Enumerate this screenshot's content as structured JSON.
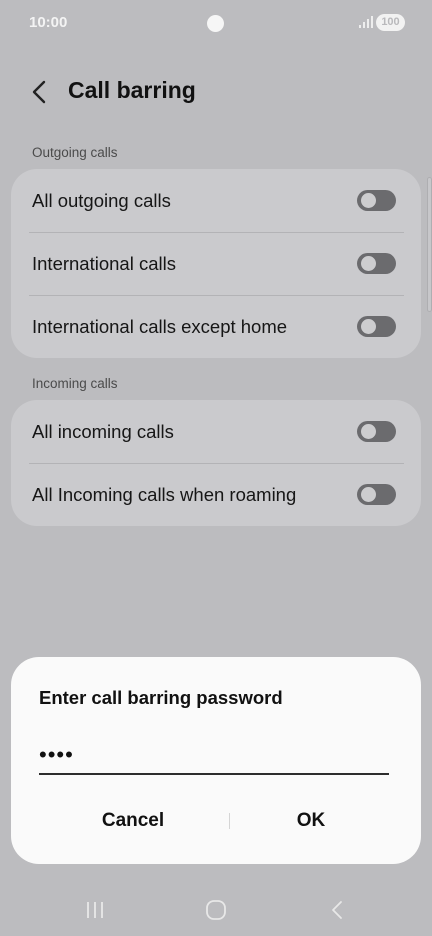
{
  "status_bar": {
    "time": "10:00",
    "battery": "100"
  },
  "header": {
    "title": "Call barring"
  },
  "sections": [
    {
      "header": "Outgoing calls",
      "items": [
        {
          "label": "All outgoing calls",
          "enabled": false
        },
        {
          "label": "International calls",
          "enabled": false
        },
        {
          "label": "International calls except home",
          "enabled": false
        }
      ]
    },
    {
      "header": "Incoming calls",
      "items": [
        {
          "label": "All incoming calls",
          "enabled": false
        },
        {
          "label": "All Incoming calls when roaming",
          "enabled": false
        }
      ]
    }
  ],
  "dialog": {
    "title": "Enter call barring password",
    "password_value": "••••",
    "cancel_label": "Cancel",
    "ok_label": "OK"
  },
  "nav_bar": {
    "buttons": [
      "recent-apps-icon",
      "home-icon",
      "back-icon"
    ]
  }
}
